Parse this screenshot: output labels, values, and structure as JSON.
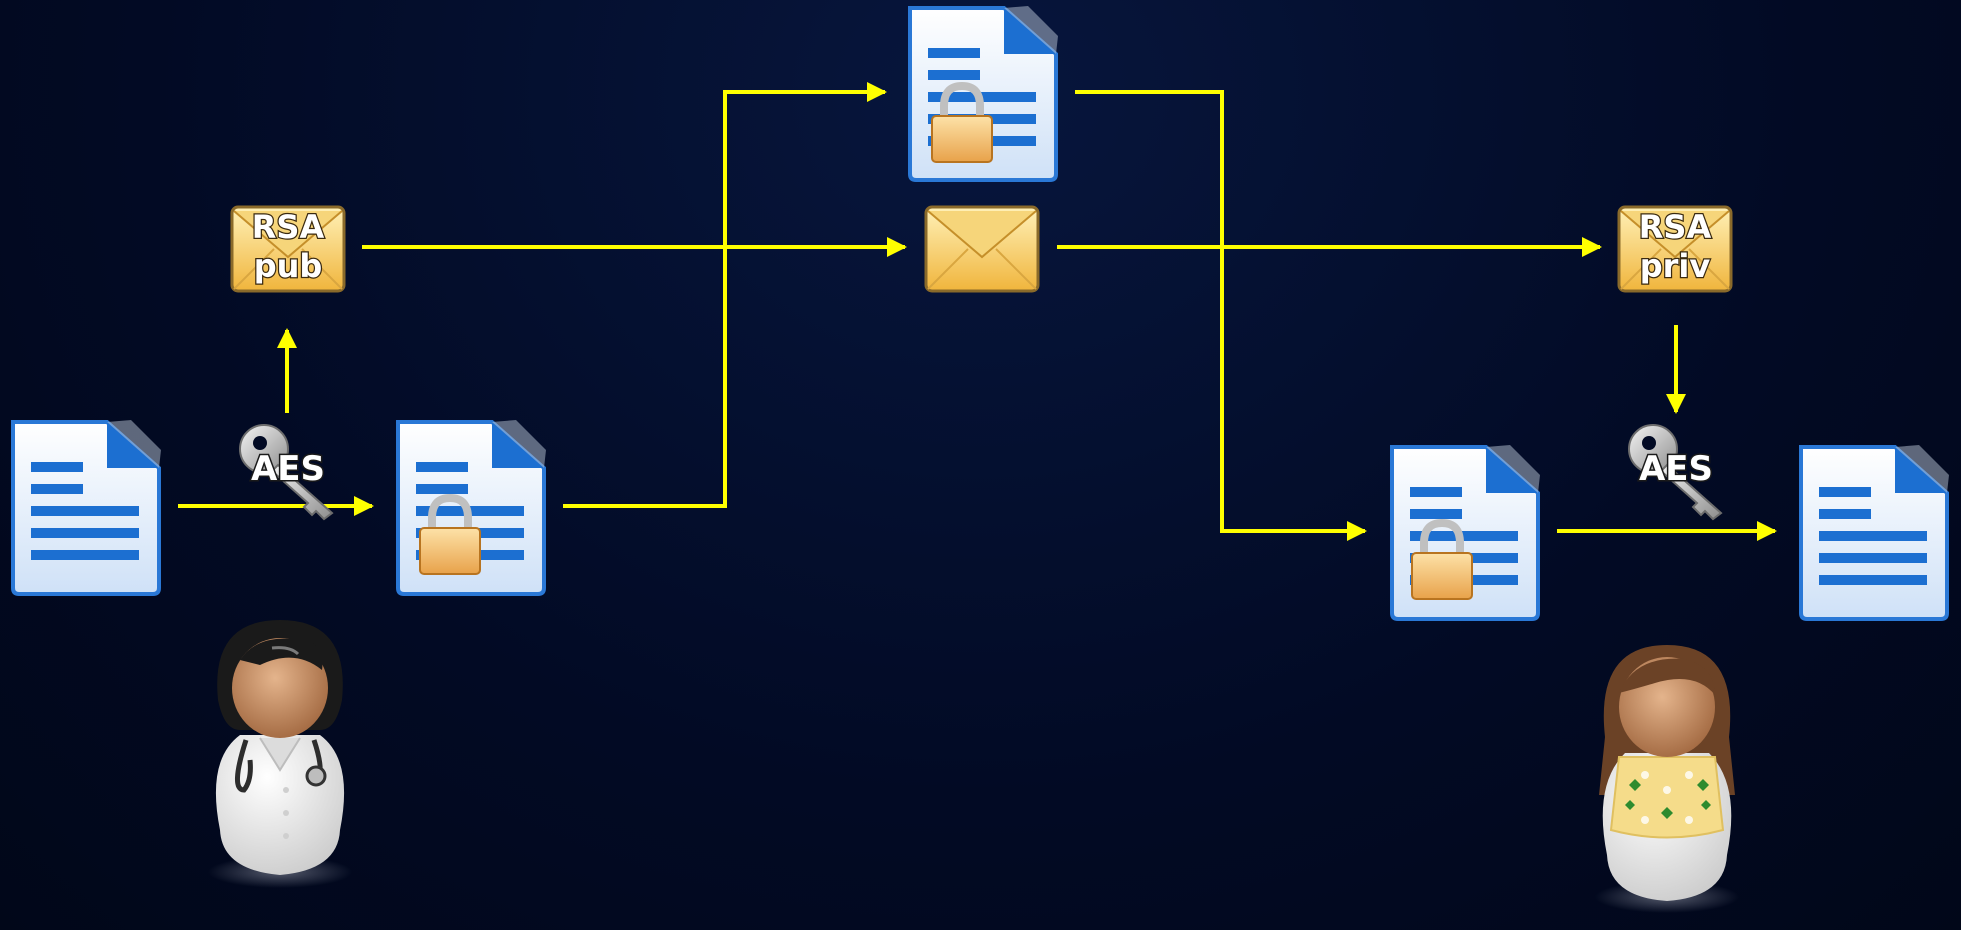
{
  "colors": {
    "background": "#020a24",
    "arrow": "#ffff00",
    "document_blue": "#1c6fd1",
    "envelope_gold": "#f3c24f",
    "lock_gold": "#f0b860"
  },
  "nodes": {
    "plaintext_doc_sender": {
      "icon": "document-icon"
    },
    "aes_key_sender": {
      "icon": "key-icon",
      "label": "AES"
    },
    "rsa_pub_envelope": {
      "icon": "envelope-icon",
      "label_line1": "RSA",
      "label_line2": "pub"
    },
    "encrypted_doc_sender": {
      "icon": "locked-document-icon"
    },
    "encrypted_doc_transit": {
      "icon": "locked-document-icon"
    },
    "encrypted_key_envelope": {
      "icon": "envelope-icon"
    },
    "rsa_priv_envelope": {
      "icon": "envelope-icon",
      "label_line1": "RSA",
      "label_line2": "priv"
    },
    "aes_key_receiver": {
      "icon": "key-icon",
      "label": "AES"
    },
    "encrypted_doc_receiver": {
      "icon": "locked-document-icon"
    },
    "plaintext_doc_receiver": {
      "icon": "document-icon"
    },
    "sender_person": {
      "icon": "doctor-avatar-icon"
    },
    "receiver_person": {
      "icon": "woman-avatar-icon"
    }
  }
}
